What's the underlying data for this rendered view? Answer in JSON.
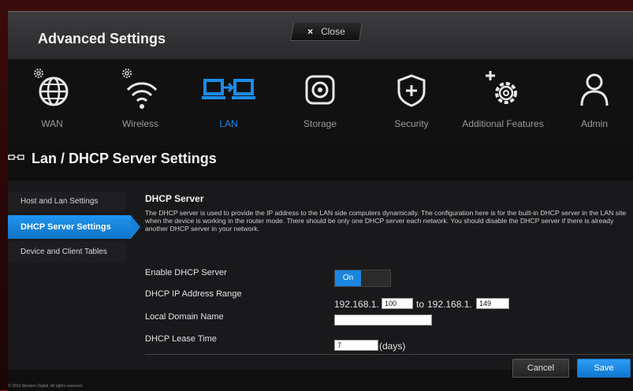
{
  "window": {
    "title": "Advanced Settings",
    "close_label": "Close",
    "close_icon": "×"
  },
  "nav": {
    "items": [
      {
        "label": "WAN",
        "icon": "globe-with-gear-icon"
      },
      {
        "label": "Wireless",
        "icon": "wifi-with-gear-icon"
      },
      {
        "label": "LAN",
        "icon": "lan-computers-icon",
        "active": true
      },
      {
        "label": "Storage",
        "icon": "storage-disc-icon"
      },
      {
        "label": "Security",
        "icon": "shield-plus-icon"
      },
      {
        "label": "Additional Features",
        "icon": "gear-plus-icon"
      },
      {
        "label": "Admin",
        "icon": "person-icon"
      }
    ],
    "active_color": "#1d8ce6"
  },
  "section": {
    "title": "Lan / DHCP Server Settings"
  },
  "sidebar": {
    "items": [
      {
        "label": "Host and Lan Settings"
      },
      {
        "label": "DHCP Server Settings",
        "active": true
      },
      {
        "label": "Device and Client Tables"
      }
    ]
  },
  "main": {
    "heading": "DHCP Server",
    "description": "The DHCP server is used to provide the IP address to the LAN side computers dynamically. The configuration here is for the built-in DHCP server in the LAN site when the device is working in the router mode. There should be only one DHCP server each network. You should disable the DHCP server if there is already another DHCP server in your network.",
    "enable_label": "Enable DHCP Server",
    "toggle_on": "On",
    "range_label": "DHCP IP Address Range",
    "range_prefix_start": "192.168.1.",
    "range_start": "100",
    "range_to": "to",
    "range_prefix_end": "192.168.1.",
    "range_end": "149",
    "domain_label": "Local Domain Name",
    "domain_value": "",
    "lease_label": "DHCP Lease Time",
    "lease_value": "7",
    "lease_unit": "(days)"
  },
  "buttons": {
    "cancel": "Cancel",
    "save": "Save"
  },
  "footer": {
    "copyright": "© 2013 Western Digital. All rights reserved."
  },
  "colors": {
    "accent": "#1a86e0",
    "background": "#0f0f10"
  }
}
